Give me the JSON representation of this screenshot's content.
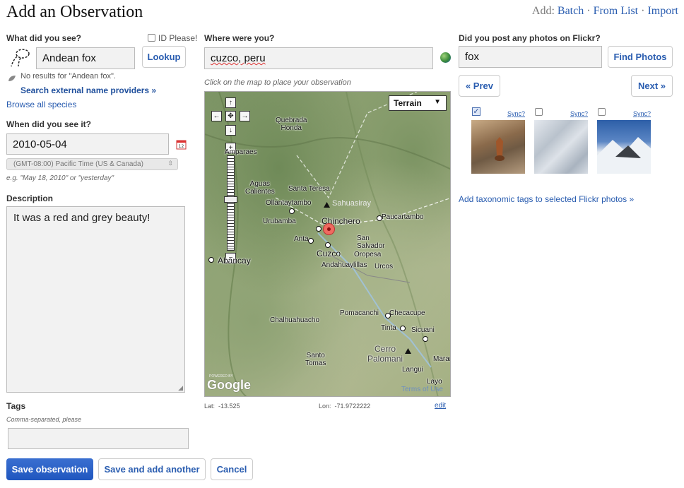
{
  "page": {
    "title": "Add an Observation"
  },
  "toplinks": {
    "prefix": "Add:",
    "batch": "Batch",
    "sep1": "·",
    "from_list": "From List",
    "sep2": "·",
    "import": "Import"
  },
  "species": {
    "label": "What did you see?",
    "id_please": "ID Please!",
    "value": "Andean fox",
    "lookup": "Lookup",
    "no_results": "No results for \"Andean fox\".",
    "search_external": "Search external name providers »",
    "browse": "Browse all species"
  },
  "date": {
    "label": "When did you see it?",
    "value": "2010-05-04",
    "timezone": "(GMT-08:00) Pacific Time (US & Canada)",
    "hint": "e.g. \"May 18, 2010\" or \"yesterday\""
  },
  "description": {
    "label": "Description",
    "value": "It was a red and grey beauty!"
  },
  "tags": {
    "label": "Tags",
    "hint": "Comma-separated, please",
    "value": ""
  },
  "buttons": {
    "save": "Save observation",
    "save_another": "Save and add another",
    "cancel": "Cancel"
  },
  "location": {
    "label": "Where were you?",
    "value": "cuzco, peru",
    "map_hint": "Click on the map to place your observation",
    "map_type": "Terrain",
    "lat_label": "Lat:",
    "lat": "-13.525",
    "lon_label": "Lon:",
    "lon": "-71.9722222",
    "edit": "edit",
    "places": [
      {
        "name": "Quebrada\nHonda",
        "pale": false
      },
      {
        "name": "Amparaes",
        "pale": false
      },
      {
        "name": "Aguas\nCalientes",
        "pale": false
      },
      {
        "name": "Santa Teresa",
        "pale": false
      },
      {
        "name": "Ollantaytambo",
        "pale": false
      },
      {
        "name": "Urubamba",
        "pale": false
      },
      {
        "name": "Chinchero",
        "pale": false
      },
      {
        "name": "Paucartambo",
        "pale": false
      },
      {
        "name": "Anta",
        "pale": false
      },
      {
        "name": "Cuzco",
        "pale": false
      },
      {
        "name": "San\nSalvador",
        "pale": false
      },
      {
        "name": "Oropesa",
        "pale": false
      },
      {
        "name": "Andahuaylillas",
        "pale": false
      },
      {
        "name": "Urcos",
        "pale": false
      },
      {
        "name": "Abancay",
        "pale": false
      },
      {
        "name": "Pomacanchi",
        "pale": false
      },
      {
        "name": "Checacupe",
        "pale": false
      },
      {
        "name": "Chalhuahuacho",
        "pale": false
      },
      {
        "name": "Tinta",
        "pale": false
      },
      {
        "name": "Sicuani",
        "pale": false
      },
      {
        "name": "Santo\nTomas",
        "pale": false
      },
      {
        "name": "Cerro\nPalomani",
        "pale": false
      },
      {
        "name": "Marangani",
        "pale": false
      },
      {
        "name": "Langui",
        "pale": false
      },
      {
        "name": "Layo",
        "pale": false
      },
      {
        "name": "Sahuasiray",
        "pale": true
      },
      {
        "name": "Terms of Use",
        "pale": true
      }
    ],
    "google": "Google",
    "powered_by": "POWERED BY"
  },
  "flickr": {
    "label": "Did you post any photos on Flickr?",
    "value": "fox",
    "find": "Find Photos",
    "prev": "« Prev",
    "next": "Next »",
    "photos": [
      {
        "sync": "Sync?",
        "checked": true,
        "icon": "fox-photo"
      },
      {
        "sync": "Sync?",
        "checked": false,
        "icon": "snow-photo"
      },
      {
        "sync": "Sync?",
        "checked": false,
        "icon": "mountain-photo"
      }
    ],
    "tags_link": "Add taxonomic tags to selected Flickr photos »"
  }
}
